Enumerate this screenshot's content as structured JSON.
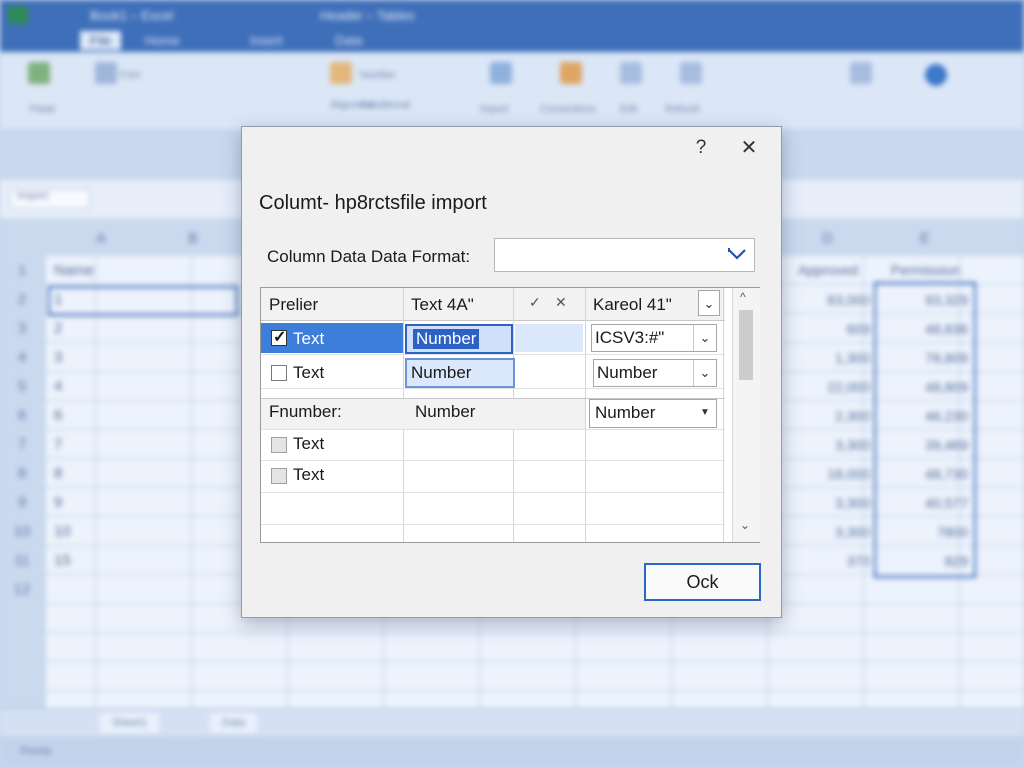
{
  "background": {
    "titlebar_text": [
      "Book1 – Excel",
      "Header – Tables"
    ],
    "tabs": [
      "File",
      "Home",
      "Insert",
      "Data"
    ],
    "ribbon_labels": [
      "Paste",
      "Font",
      "Alignment",
      "Number",
      "Conditional",
      "Import",
      "Connections",
      "Edit",
      "Refresh"
    ],
    "namebox": "Import",
    "columns": [
      "A",
      "B",
      "C",
      "D",
      "E"
    ],
    "header_cells": {
      "A": "Name",
      "D": "Approved",
      "E": "Permission"
    },
    "row_numbers": [
      "1",
      "2",
      "3",
      "4",
      "5",
      "6",
      "7",
      "8",
      "9",
      "10",
      "11",
      "12"
    ],
    "col_a_values": [
      "1",
      "2",
      "3",
      "4",
      "6",
      "7",
      "8",
      "9",
      "10",
      "15"
    ],
    "col_d_values": [
      "83,000",
      "609",
      "1,300",
      "22,000",
      "2,300",
      "3,300",
      "18,000",
      "3,300",
      "3,300",
      "370"
    ],
    "col_e_values": [
      "93,329",
      "48,636",
      "78,809",
      "48,809",
      "46,230",
      "39,469",
      "48,730",
      "40,577",
      "7800",
      "829"
    ],
    "sheet_tabs": [
      "Sheet1",
      "Data"
    ],
    "status_text": "Ready"
  },
  "dialog": {
    "help_label": "?",
    "close_label": "✕",
    "title": "Columt- hp8rctsfile import",
    "format_label": "Column Data Data Format:",
    "format_value": "",
    "format_chevron": "chevron-down-icon",
    "table": {
      "headers": [
        "Prelier",
        "Text 4A\"",
        "✓",
        "✕",
        "Kareol 41\""
      ],
      "header_dropdown_arrow": "⌄",
      "rows": [
        {
          "checkbox": "checked",
          "label": "Text",
          "col2": "Number",
          "dropdown": "ICSV3:#\"",
          "selected": true
        },
        {
          "checkbox": "unchecked",
          "label": "Text",
          "col2": "Number",
          "dropdown": "Number"
        },
        {
          "label": "Fnumber:",
          "col2": "Number",
          "dropdown": "Number",
          "shaded": true
        },
        {
          "checkbox": "gray",
          "label": "Text"
        },
        {
          "checkbox": "gray",
          "label": "Text"
        }
      ],
      "scroll_up": "^",
      "scroll_down": "⌄"
    },
    "ok_label": "Ock"
  },
  "colors": {
    "accent": "#2d62c4",
    "selection": "#3d7edb",
    "titlebar": "#3f6fb9"
  }
}
